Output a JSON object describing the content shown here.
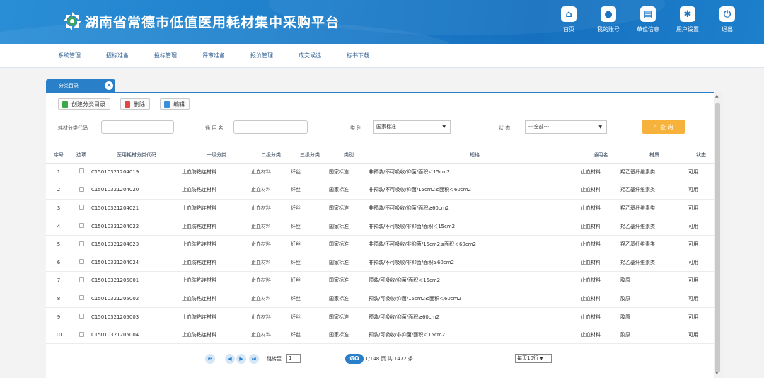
{
  "header": {
    "title": "湖南省常德市低值医用耗材集中采购平台",
    "icons": [
      {
        "label": "首页",
        "icon": "home-icon",
        "glyph": "⌂"
      },
      {
        "label": "我的账号",
        "icon": "user-icon",
        "glyph": "●"
      },
      {
        "label": "单位信息",
        "icon": "document-icon",
        "glyph": "▤"
      },
      {
        "label": "用户设置",
        "icon": "gear-icon",
        "glyph": "✱"
      },
      {
        "label": "退出",
        "icon": "power-icon",
        "glyph": "⏻"
      }
    ]
  },
  "nav": [
    "系统管理",
    "招标准备",
    "投标管理",
    "评审准备",
    "报价管理",
    "成交候选",
    "标书下载"
  ],
  "tab": {
    "label": "分类目录",
    "close": "×"
  },
  "toolbar": {
    "create": "创建分类目录",
    "delete": "删除",
    "edit": "编辑"
  },
  "filter": {
    "code_label": "耗材分类代码",
    "name_label": "通 用 名",
    "category_label": "类 别",
    "category_value": "国家标准",
    "status_label": "状  态",
    "status_value": "---全部---",
    "search": "查 询"
  },
  "table": {
    "headers": [
      "序号",
      "选项",
      "医用耗材分类代码",
      "一级分类",
      "二级分类",
      "三级分类",
      "类别",
      "规格",
      "通用名",
      "材质",
      "状态"
    ],
    "rows": [
      {
        "no": "1",
        "code": "C15010321204019",
        "l1": "止血防粘连材料",
        "l2": "止血材料",
        "l3": "纤丝",
        "cat": "国家标准",
        "spec": "非预装/不可吸收/抑菌/面积＜15cm2",
        "name": "止血材料",
        "material": "羟乙基纤维素类",
        "status": "可用"
      },
      {
        "no": "2",
        "code": "C15010321204020",
        "l1": "止血防粘连材料",
        "l2": "止血材料",
        "l3": "纤丝",
        "cat": "国家标准",
        "spec": "非预装/不可吸收/抑菌/15cm2≤面积＜60cm2",
        "name": "止血材料",
        "material": "羟乙基纤维素类",
        "status": "可用"
      },
      {
        "no": "3",
        "code": "C15010321204021",
        "l1": "止血防粘连材料",
        "l2": "止血材料",
        "l3": "纤丝",
        "cat": "国家标准",
        "spec": "非预装/不可吸收/抑菌/面积≥60cm2",
        "name": "止血材料",
        "material": "羟乙基纤维素类",
        "status": "可用"
      },
      {
        "no": "4",
        "code": "C15010321204022",
        "l1": "止血防粘连材料",
        "l2": "止血材料",
        "l3": "纤丝",
        "cat": "国家标准",
        "spec": "非预装/不可吸收/非抑菌/面积＜15cm2",
        "name": "止血材料",
        "material": "羟乙基纤维素类",
        "status": "可用"
      },
      {
        "no": "5",
        "code": "C15010321204023",
        "l1": "止血防粘连材料",
        "l2": "止血材料",
        "l3": "纤丝",
        "cat": "国家标准",
        "spec": "非预装/不可吸收/非抑菌/15cm2≤面积＜60cm2",
        "name": "止血材料",
        "material": "羟乙基纤维素类",
        "status": "可用"
      },
      {
        "no": "6",
        "code": "C15010321204024",
        "l1": "止血防粘连材料",
        "l2": "止血材料",
        "l3": "纤丝",
        "cat": "国家标准",
        "spec": "非预装/不可吸收/非抑菌/面积≥60cm2",
        "name": "止血材料",
        "material": "羟乙基纤维素类",
        "status": "可用"
      },
      {
        "no": "7",
        "code": "C15010321205001",
        "l1": "止血防粘连材料",
        "l2": "止血材料",
        "l3": "纤丝",
        "cat": "国家标准",
        "spec": "预装/可吸收/抑菌/面积＜15cm2",
        "name": "止血材料",
        "material": "胶原",
        "status": "可用"
      },
      {
        "no": "8",
        "code": "C15010321205002",
        "l1": "止血防粘连材料",
        "l2": "止血材料",
        "l3": "纤丝",
        "cat": "国家标准",
        "spec": "预装/可吸收/抑菌/15cm2≤面积＜60cm2",
        "name": "止血材料",
        "material": "胶原",
        "status": "可用"
      },
      {
        "no": "9",
        "code": "C15010321205003",
        "l1": "止血防粘连材料",
        "l2": "止血材料",
        "l3": "纤丝",
        "cat": "国家标准",
        "spec": "预装/可吸收/抑菌/面积≥60cm2",
        "name": "止血材料",
        "material": "胶原",
        "status": "可用"
      },
      {
        "no": "10",
        "code": "C15010321205004",
        "l1": "止血防粘连材料",
        "l2": "止血材料",
        "l3": "纤丝",
        "cat": "国家标准",
        "spec": "预装/可吸收/非抑菌/面积＜15cm2",
        "name": "止血材料",
        "material": "胶原",
        "status": "可用"
      }
    ]
  },
  "pager": {
    "jump_label": "跳转至",
    "jump_value": "1",
    "go": "GO",
    "info": "1/148 页 共 1472 条",
    "page_size": "每页10行"
  },
  "colors": {
    "brand": "#1e7fcb",
    "search": "#f7b23b",
    "tab": "#2a7fc9"
  }
}
